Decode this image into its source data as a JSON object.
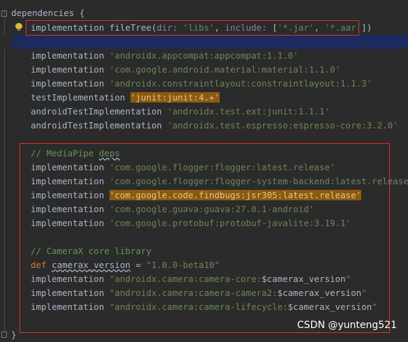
{
  "editor": {
    "line_open": "dependencies {",
    "filetree": {
      "kw": "implementation",
      "call": "fileTree(",
      "p_dir": "dir:",
      "v_dir": "'libs'",
      "comma1": ", ",
      "p_include": "include:",
      "lb": " [",
      "v_jar": "'*.jar'",
      "comma2": ", ",
      "v_aar": "'*.aar'",
      "rb": "])"
    },
    "block1": [
      {
        "kw": "implementation",
        "str": "'androidx.appcompat:appcompat:1.1.0'"
      },
      {
        "kw": "implementation",
        "str": "'com.google.android.material:material:1.1.0'"
      },
      {
        "kw": "implementation",
        "str": "'androidx.constraintlayout:constraintlayout:1.1.3'"
      },
      {
        "kw": "testImplementation",
        "str": "'junit:junit:4.+'"
      },
      {
        "kw": "androidTestImplementation",
        "str": "'androidx.test.ext:junit:1.1.1'"
      },
      {
        "kw": "androidTestImplementation",
        "str": "'androidx.test.espresso:espresso-core:3.2.0'"
      }
    ],
    "mediapipe_comment_prefix": "// MediaPipe ",
    "mediapipe_comment_word": "deps",
    "block2": [
      {
        "kw": "implementation",
        "str": "'com.google.flogger:flogger:latest.release'"
      },
      {
        "kw": "implementation",
        "str": "'com.google.flogger:flogger-system-backend:latest.release'"
      },
      {
        "kw": "implementation",
        "str": "'com.google.code.findbugs:jsr305:latest.release'"
      },
      {
        "kw": "implementation",
        "str": "'com.google.guava:guava:27.0.1-android'"
      },
      {
        "kw": "implementation",
        "str": "'com.google.protobuf:protobuf-javalite:3.19.1'"
      }
    ],
    "camerax_comment": "// CameraX core library",
    "def_line": {
      "kw": "def",
      "name": "camerax_version",
      "eq": " = ",
      "val": "\"1.0.0-beta10\""
    },
    "block3": [
      {
        "kw": "implementation",
        "str": "\"androidx.camera:camera-core:",
        "var": "$camerax_version",
        "end": "\""
      },
      {
        "kw": "implementation",
        "str": "\"androidx.camera:camera-camera2:",
        "var": "$camerax_version",
        "end": "\""
      },
      {
        "kw": "implementation",
        "str": "\"androidx.camera:camera-lifecycle:",
        "var": "$camerax_version",
        "end": "\""
      }
    ],
    "line_close": "}"
  },
  "watermark": "CSDN @yunteng521",
  "colors": {
    "highlight": "#8a5a10",
    "box": "#e0302a",
    "caret_line": "#1c2a5e"
  },
  "icons": [
    "fold-marker-icon",
    "intention-bulb-icon"
  ]
}
